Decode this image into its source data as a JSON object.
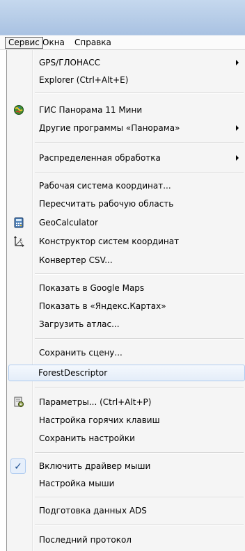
{
  "menubar": {
    "items": [
      "Сервис",
      "Окна",
      "Справка"
    ],
    "open_index": 0
  },
  "menu": {
    "items": [
      {
        "label": "GPS/ГЛОНАСС",
        "submenu": true
      },
      {
        "label": "Explorer (Ctrl+Alt+E)"
      },
      {
        "label": "ГИС Панорама 11 Мини",
        "icon": "globe-icon"
      },
      {
        "label": "Другие программы «Панорама»",
        "submenu": true
      },
      {
        "label": "Распределенная обработка",
        "submenu": true
      },
      {
        "label": "Рабочая система координат..."
      },
      {
        "label": "Пересчитать рабочую область"
      },
      {
        "label": "GeoCalculator",
        "icon": "calculator-icon"
      },
      {
        "label": "Конструктор систем координат",
        "icon": "axes-icon"
      },
      {
        "label": "Конвертер CSV..."
      },
      {
        "label": "Показать в Google Maps"
      },
      {
        "label": "Показать в «Яндекс.Картах»"
      },
      {
        "label": "Загрузить атлас..."
      },
      {
        "label": "Сохранить сцену..."
      },
      {
        "label": "ForestDescriptor",
        "hover": true
      },
      {
        "label": "Параметры... (Ctrl+Alt+P)",
        "icon": "settings-icon"
      },
      {
        "label": "Настройка горячих клавиш"
      },
      {
        "label": "Сохранить настройки"
      },
      {
        "label": "Включить драйвер мыши",
        "checked": true
      },
      {
        "label": "Настройка мыши"
      },
      {
        "label": "Подготовка данных ADS"
      },
      {
        "label": "Последний протокол"
      }
    ]
  }
}
